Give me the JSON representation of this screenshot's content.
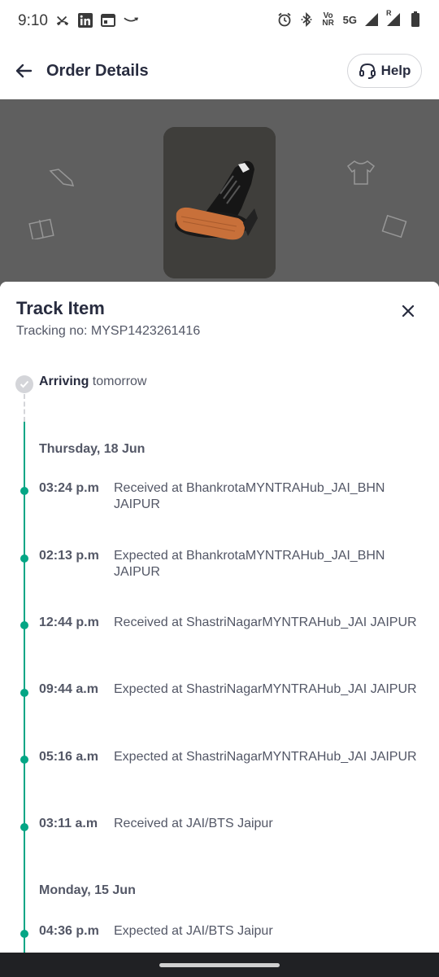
{
  "status_bar": {
    "time": "9:10",
    "left_icons": [
      "missed-call-icon",
      "linkedin-icon",
      "calendar-icon",
      "amazon-icon"
    ],
    "right_icons": [
      "alarm-icon",
      "bluetooth-icon",
      "vonr-icon",
      "5g-icon",
      "signal-icon",
      "signal-roaming-icon",
      "battery-icon"
    ],
    "vonr_line1": "Vo",
    "vonr_line2": "NR",
    "network": "5G",
    "roaming": "R"
  },
  "header": {
    "title": "Order Details",
    "help_label": "Help"
  },
  "sheet": {
    "title": "Track Item",
    "tracking_label": "Tracking no: MYSP1423261416",
    "arriving_bold": "Arriving",
    "arriving_rest": "tomorrow"
  },
  "timeline": {
    "groups": [
      {
        "date": "Thursday, 18 Jun",
        "events": [
          {
            "time": "03:24 p.m",
            "desc": "Received at BhankrotaMYNTRAHub_JAI_BHN JAIPUR"
          },
          {
            "time": "02:13 p.m",
            "desc": "Expected at BhankrotaMYNTRAHub_JAI_BHN JAIPUR"
          },
          {
            "time": "12:44 p.m",
            "desc": "Received at ShastriNagarMYNTRAHub_JAI JAIPUR"
          },
          {
            "time": "09:44 a.m",
            "desc": "Expected at ShastriNagarMYNTRAHub_JAI JAIPUR"
          },
          {
            "time": "05:16 a.m",
            "desc": "Expected at ShastriNagarMYNTRAHub_JAI JAIPUR"
          },
          {
            "time": "03:11 a.m",
            "desc": "Received at JAI/BTS Jaipur"
          }
        ]
      },
      {
        "date": "Monday, 15 Jun",
        "events": [
          {
            "time": "04:36 p.m",
            "desc": "Expected at JAI/BTS Jaipur"
          }
        ]
      }
    ]
  },
  "colors": {
    "accent": "#03a685",
    "text_primary": "#282c3f",
    "text_secondary": "#535766",
    "overlay": "#5f5f5f"
  }
}
